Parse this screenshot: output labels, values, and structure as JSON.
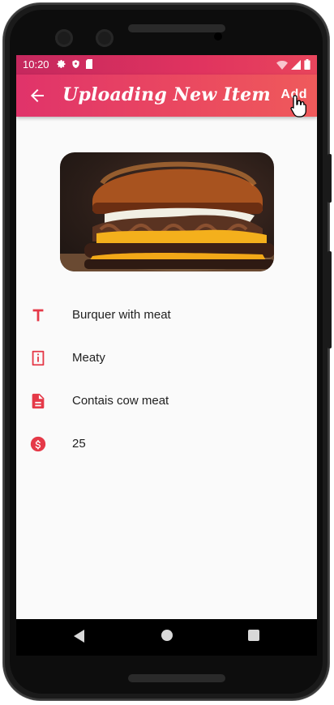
{
  "status_bar": {
    "time": "10:20",
    "left_icons": [
      "gear-icon",
      "shield-icon",
      "sd-card-icon"
    ],
    "right_icons": [
      "wifi-icon",
      "signal-icon",
      "battery-icon"
    ]
  },
  "app_bar": {
    "title": "Uploading New Item",
    "back_icon": "arrow-left-icon",
    "action_label": "Add"
  },
  "image": {
    "subject": "burger-photo"
  },
  "fields": [
    {
      "icon": "text-title-icon",
      "value": "Burquer with meat"
    },
    {
      "icon": "info-icon",
      "value": "Meaty"
    },
    {
      "icon": "description-icon",
      "value": "Contais cow meat"
    },
    {
      "icon": "dollar-icon",
      "value": "25"
    }
  ],
  "nav_bar": {
    "buttons": [
      "back-triangle-icon",
      "home-circle-icon",
      "recents-square-icon"
    ]
  },
  "colors": {
    "accent": "#e53948",
    "app_bar_start": "#e0336a",
    "app_bar_end": "#ef5a5b"
  }
}
